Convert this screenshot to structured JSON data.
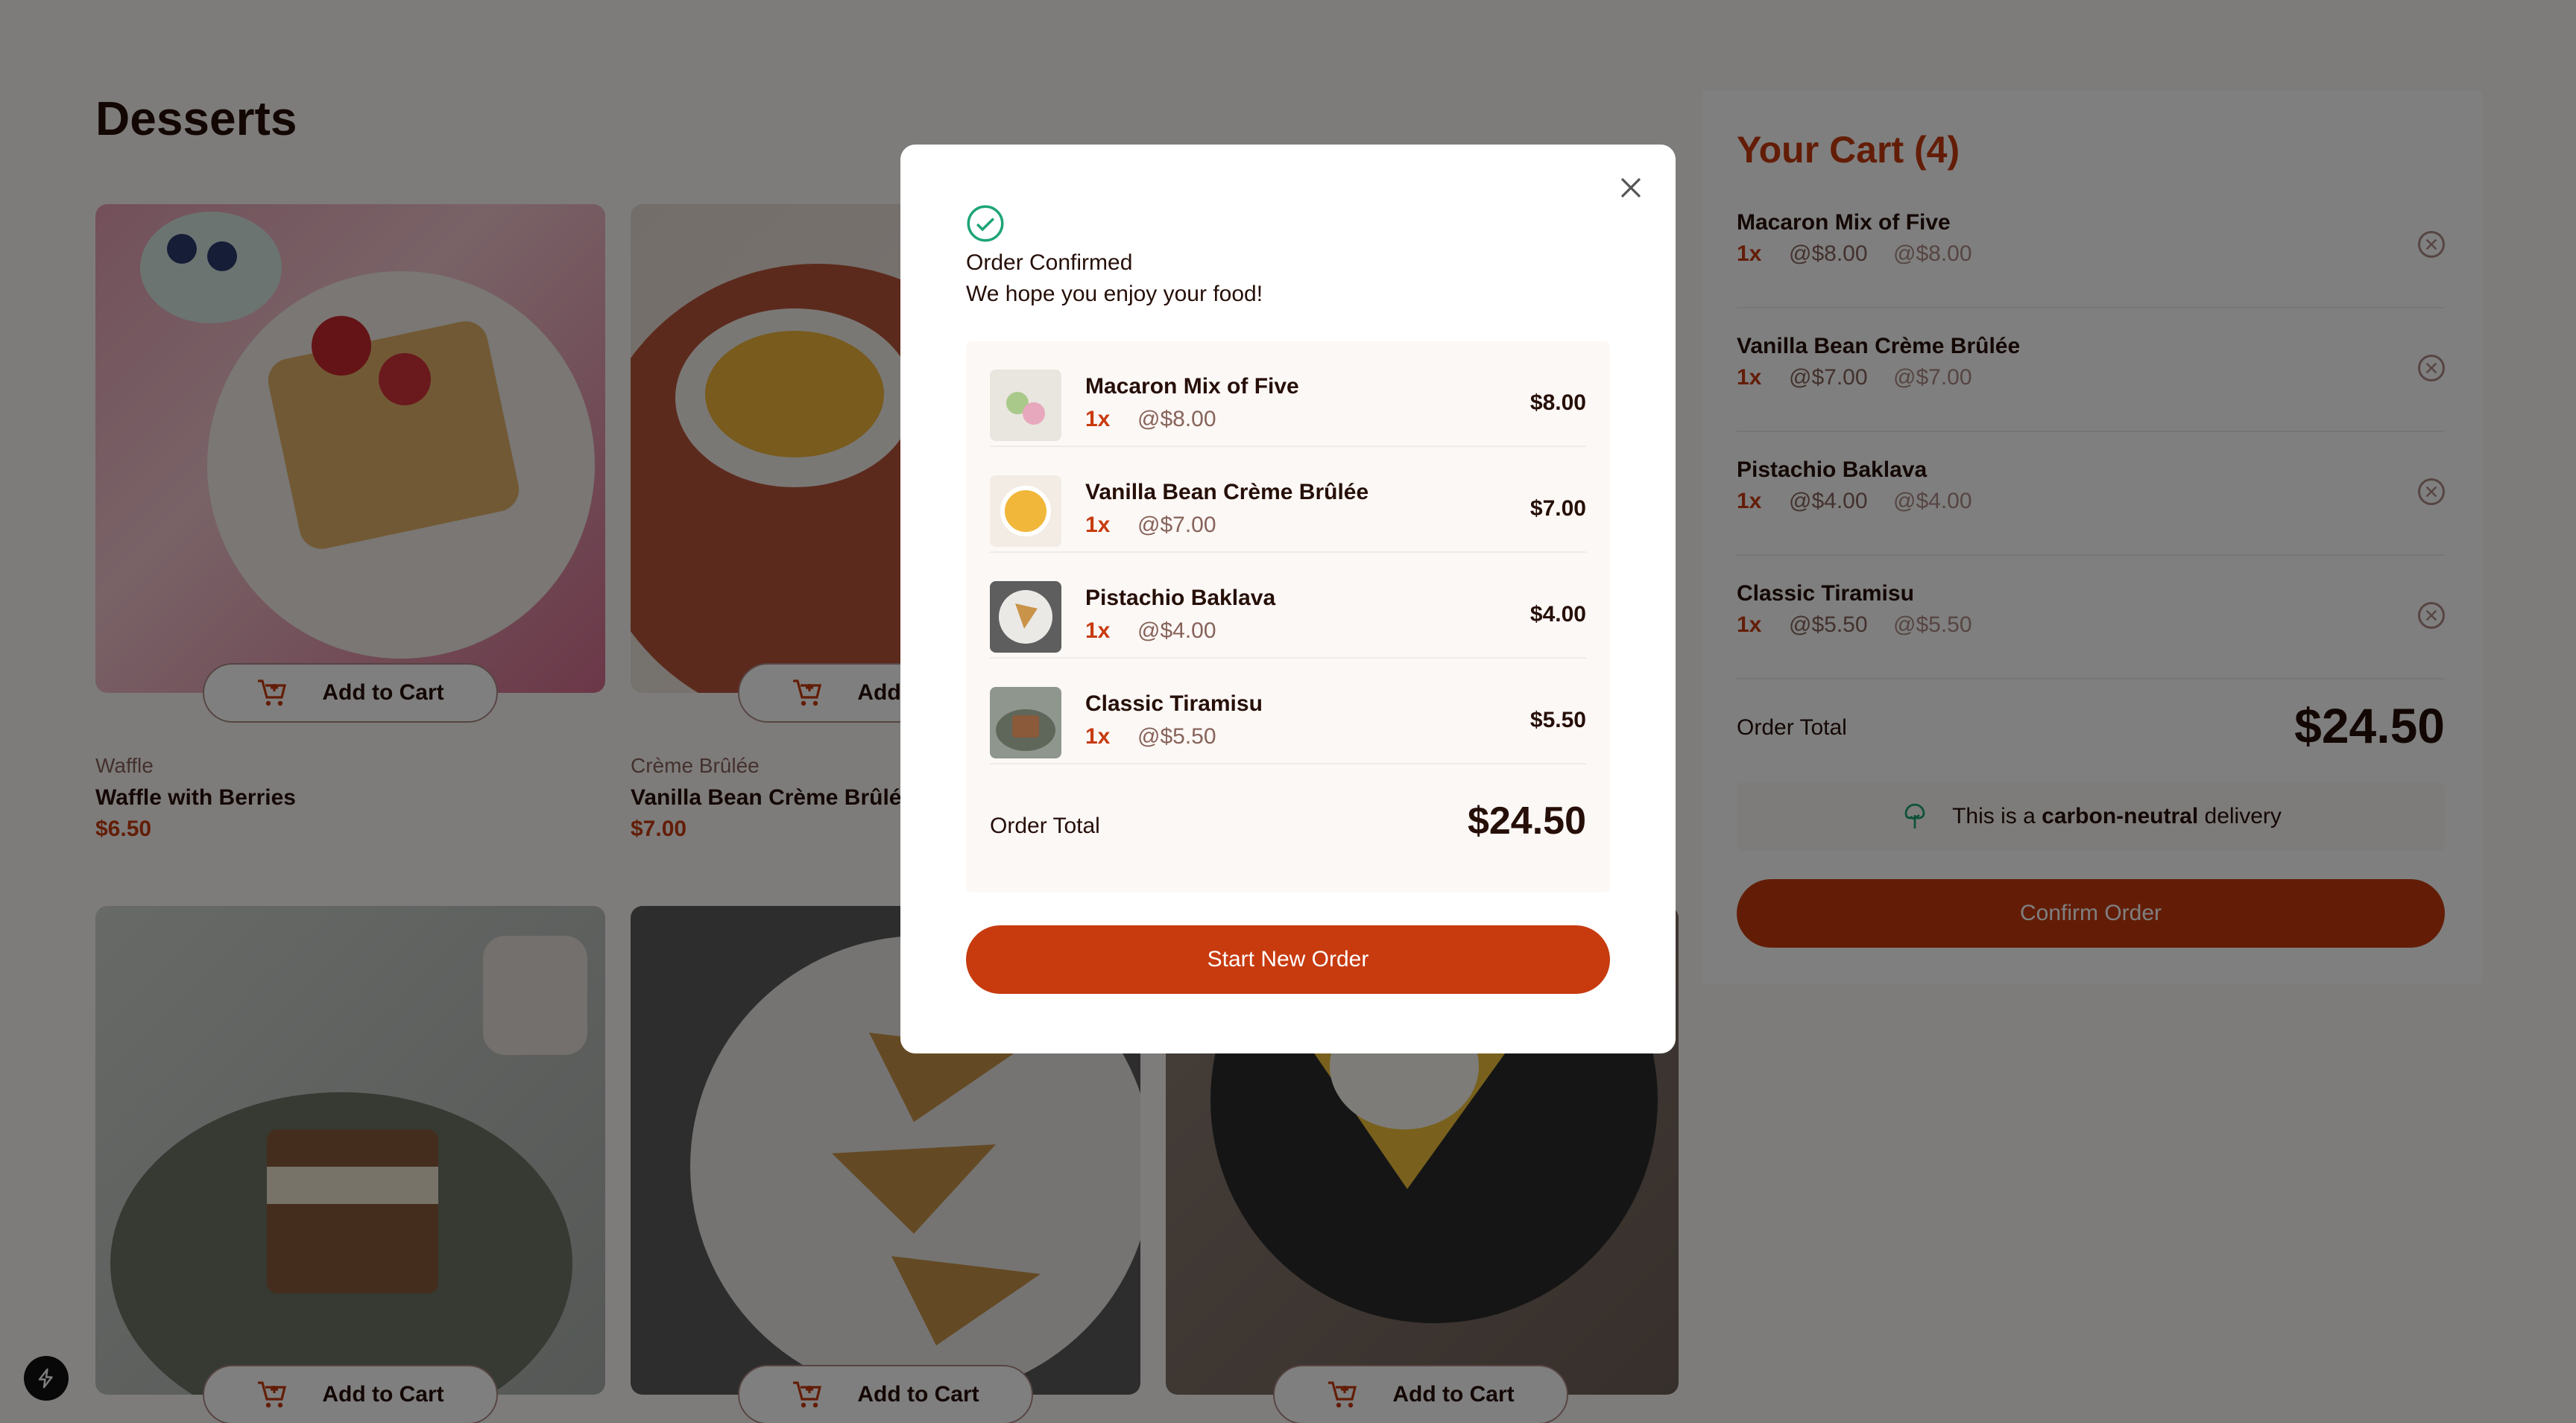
{
  "page": {
    "title": "Desserts"
  },
  "products": [
    {
      "category": "Waffle",
      "name": "Waffle with Berries",
      "price": "$6.50",
      "add_label": "Add to Cart"
    },
    {
      "category": "Crème Brûlée",
      "name": "Vanilla Bean Crème Brûlée",
      "price": "$7.00",
      "add_label": "Add to Cart"
    },
    {
      "category": "",
      "name": "",
      "price": "",
      "add_label": "Add to Cart"
    },
    {
      "category": "",
      "name": "",
      "price": "",
      "add_label": "Add to Cart"
    },
    {
      "category": "",
      "name": "",
      "price": "",
      "add_label": "Add to Cart"
    }
  ],
  "cart": {
    "title": "Your Cart (4)",
    "items": [
      {
        "name": "Macaron Mix of Five",
        "qty": "1x",
        "unit": "@$8.00",
        "subtotal": "@$8.00"
      },
      {
        "name": "Vanilla Bean Crème Brûlée",
        "qty": "1x",
        "unit": "@$7.00",
        "subtotal": "@$7.00"
      },
      {
        "name": "Pistachio Baklava",
        "qty": "1x",
        "unit": "@$4.00",
        "subtotal": "@$4.00"
      },
      {
        "name": "Classic Tiramisu",
        "qty": "1x",
        "unit": "@$5.50",
        "subtotal": "@$5.50"
      }
    ],
    "total_label": "Order Total",
    "total_value": "$24.50",
    "carbon_prefix": "This is a ",
    "carbon_bold": "carbon-neutral",
    "carbon_suffix": " delivery",
    "confirm_label": "Confirm Order"
  },
  "modal": {
    "title": "Order Confirmed",
    "subtitle": "We hope you enjoy your food!",
    "items": [
      {
        "name": "Macaron Mix of Five",
        "qty": "1x",
        "unit": "@$8.00",
        "line_total": "$8.00"
      },
      {
        "name": "Vanilla Bean Crème Brûlée",
        "qty": "1x",
        "unit": "@$7.00",
        "line_total": "$7.00"
      },
      {
        "name": "Pistachio Baklava",
        "qty": "1x",
        "unit": "@$4.00",
        "line_total": "$4.00"
      },
      {
        "name": "Classic Tiramisu",
        "qty": "1x",
        "unit": "@$5.50",
        "line_total": "$5.50"
      }
    ],
    "total_label": "Order Total",
    "total_value": "$24.50",
    "new_order_label": "Start New Order"
  },
  "icons": {
    "close": "close-icon",
    "check": "check-circle-icon",
    "cart": "add-to-cart-icon",
    "remove": "remove-item-icon",
    "tree": "carbon-neutral-tree-icon",
    "dev": "lightning-icon"
  },
  "colors": {
    "accent": "#c73b0f",
    "dark": "#260f08",
    "muted": "#87635a",
    "green": "#1ea475"
  }
}
